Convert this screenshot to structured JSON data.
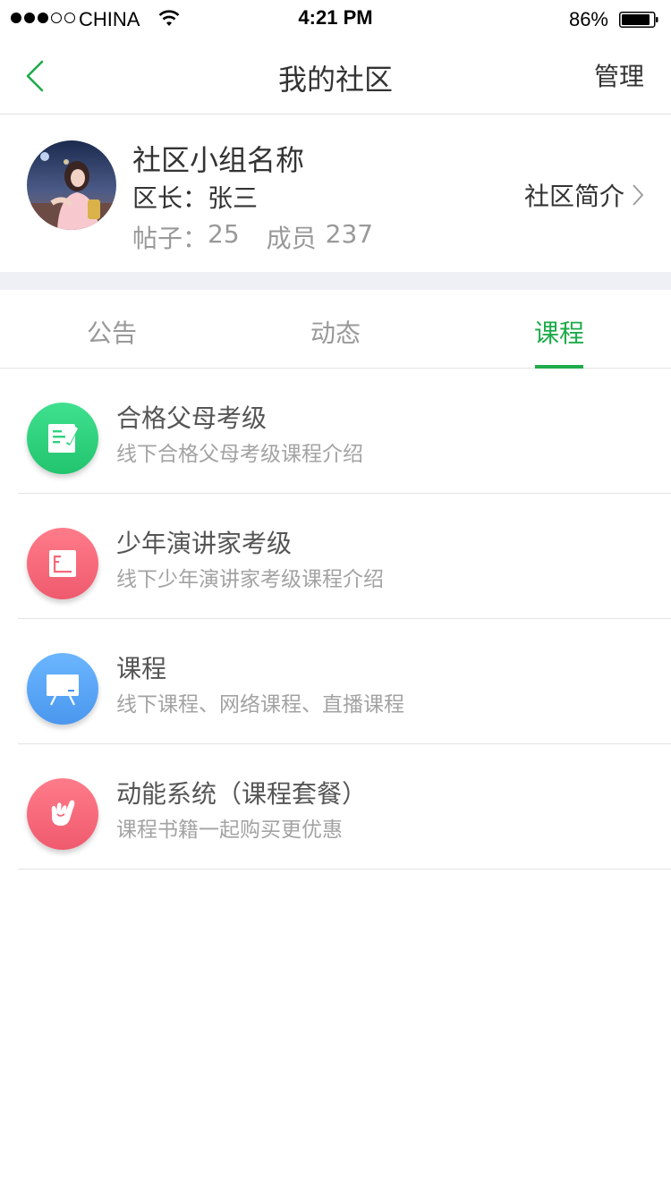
{
  "status_bar": {
    "carrier": "CHINA",
    "time": "4:21 PM",
    "battery": "86%"
  },
  "nav": {
    "title": "我的社区",
    "right_action": "管理",
    "accent_color": "#1eab4a"
  },
  "group": {
    "name": "社区小组名称",
    "leader_label": "区长：",
    "leader_name": "张三",
    "posts_label": "帖子：",
    "posts_count": "25",
    "members_label": "成员",
    "members_count": "237",
    "intro_link": "社区简介"
  },
  "tabs": [
    {
      "label": "公告",
      "active": false
    },
    {
      "label": "动态",
      "active": false
    },
    {
      "label": "课程",
      "active": true
    }
  ],
  "courses": [
    {
      "title": "合格父母考级",
      "subtitle": "线下合格父母考级课程介绍",
      "icon": "edit-note-icon",
      "color": "#2fd37e"
    },
    {
      "title": "少年演讲家考级",
      "subtitle": "线下少年演讲家考级课程介绍",
      "icon": "document-icon",
      "color": "#f5687a"
    },
    {
      "title": "课程",
      "subtitle": "线下课程、网络课程、直播课程",
      "icon": "presentation-board-icon",
      "color": "#58a8f5"
    },
    {
      "title": "动能系统（课程套餐）",
      "subtitle": "课程书籍一起购买更优惠",
      "icon": "hand-gesture-icon",
      "color": "#f5687a"
    }
  ]
}
